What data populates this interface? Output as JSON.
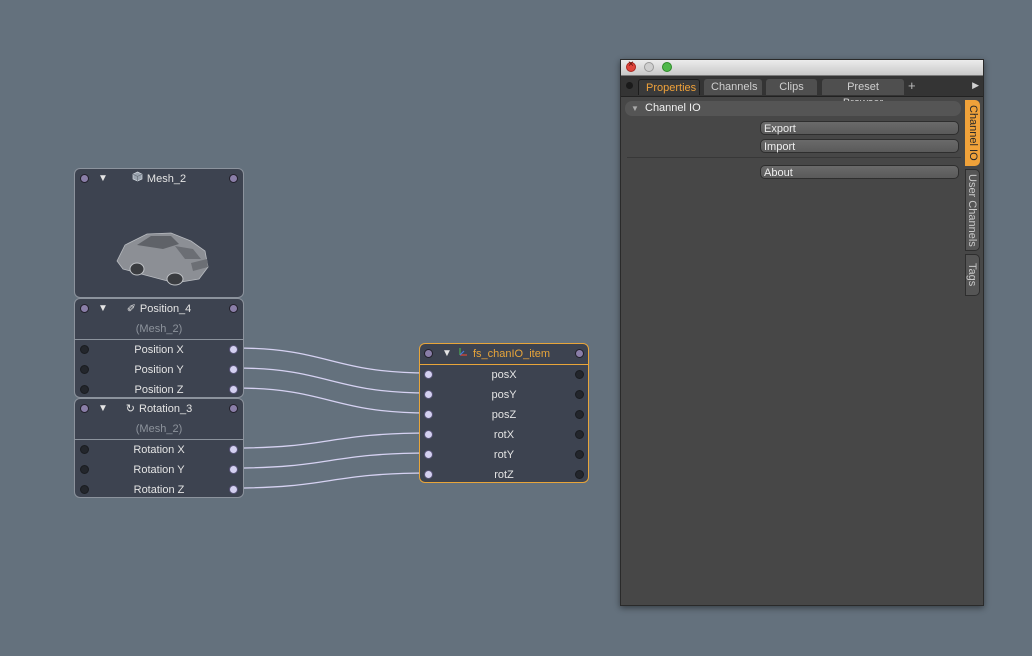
{
  "schematic": {
    "mesh_node": {
      "title": "Mesh_2"
    },
    "position_node": {
      "title": "Position_4",
      "subtitle": "(Mesh_2)",
      "channels": [
        "Position X",
        "Position Y",
        "Position Z"
      ]
    },
    "rotation_node": {
      "title": "Rotation_3",
      "subtitle": "(Mesh_2)",
      "channels": [
        "Rotation X",
        "Rotation Y",
        "Rotation Z"
      ]
    },
    "chanio_node": {
      "title": "fs_chanIO_item",
      "channels": [
        "posX",
        "posY",
        "posZ",
        "rotX",
        "rotY",
        "rotZ"
      ]
    },
    "accent_color": "#e8a53a"
  },
  "properties_window": {
    "tabs": [
      "Properties",
      "Channels",
      "Clips",
      "Preset Browser"
    ],
    "add_tab": "+",
    "section_title": "Channel IO",
    "buttons": {
      "export": "Export",
      "import": "Import",
      "about": "About"
    },
    "side_tabs": [
      "Channel IO",
      "User Channels",
      "Tags"
    ],
    "active_color": "#f0a23a"
  }
}
